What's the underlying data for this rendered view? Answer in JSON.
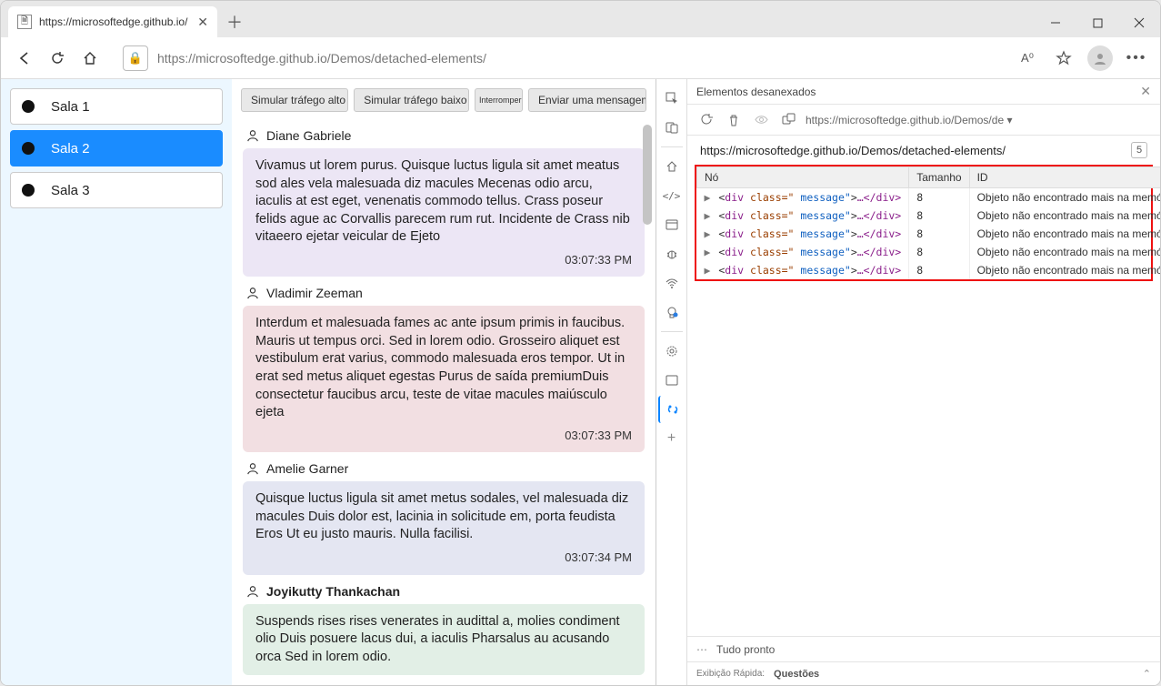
{
  "browser": {
    "tab_title": "https://microsoftedge.github.io/",
    "url": "https://microsoftedge.github.io/Demos/detached-elements/"
  },
  "sidebar": {
    "rooms": [
      {
        "label": "Sala 1",
        "active": false
      },
      {
        "label": "Sala 2",
        "active": true
      },
      {
        "label": "Sala 3",
        "active": false
      }
    ]
  },
  "buttons": {
    "high": "Simular tráfego alto",
    "low": "Simular tráfego baixo",
    "stop": "Interromper",
    "send": "Enviar uma mensagem"
  },
  "messages": [
    {
      "from": "Diane Gabriele",
      "color": "c1",
      "body": "Vivamus ut lorem purus. Quisque luctus ligula sit amet meatus sod ales vela malesuada diz macules  Mecenas odio arcu, iaculis at est eget, venenatis commodo tellus. Crass poseur felids ague ac Corvallis parecem rum rut. Incidente de Crass nib vitaeero ejetar veicular de Ejeto",
      "time": "03:07:33 PM"
    },
    {
      "from": "Vladimir Zeeman",
      "color": "c2",
      "body": "Interdum et malesuada fames ac ante ipsum primis in faucibus. Mauris ut tempus orci. Sed in lorem odio. Grosseiro aliquet est vestibulum erat varius, commodo malesuada eros tempor. Ut in erat sed metus aliquet egestas Purus de saída premiumDuis consectetur faucibus arcu, teste de vitae macules maiúsculo ejeta",
      "time": "03:07:33 PM"
    },
    {
      "from": "Amelie Garner",
      "color": "c3",
      "body": "Quisque luctus ligula sit amet metus sodales, vel malesuada diz macules       Duis dolor est, lacinia in solicitude em, porta feudista Eros       Ut eu justo mauris. Nulla facilisi.",
      "time": "03:07:34 PM"
    },
    {
      "from": "Joyikutty Thankachan",
      "color": "c4",
      "body": "Suspends rises rises venerates in audittal a, molies condiment olio       Duis posuere lacus dui, a iaculis Pharsalus au acusando orca       Sed in lorem odio.",
      "time": ""
    }
  ],
  "devtools": {
    "panel_title": "Elementos desanexados",
    "dropdown": "https://microsoftedge.github.io/Demos/de",
    "url": "https://microsoftedge.github.io/Demos/detached-elements/",
    "badge": "5",
    "columns": {
      "node": "Nó",
      "size": "Tamanho",
      "id": "ID"
    },
    "rows": [
      {
        "tag": "div",
        "attr": "class=\"",
        "val": "message\"",
        "close": "…</div>",
        "size": "8",
        "id": "Objeto não encontrado mais na memória"
      },
      {
        "tag": "div",
        "attr": "class=\"",
        "val": "message\"",
        "close": "…</div>",
        "size": "8",
        "id": "Objeto não encontrado mais na memória"
      },
      {
        "tag": "div",
        "attr": "class=\"",
        "val": "message\"",
        "close": "…</div>",
        "size": "8",
        "id": "Objeto não encontrado mais na memória"
      },
      {
        "tag": "div",
        "attr": "class=\"",
        "val": "message\"",
        "close": "…</div>",
        "size": "8",
        "id": "Objeto não encontrado mais na memória"
      },
      {
        "tag": "div",
        "attr": "class=\"",
        "val": "message\"",
        "close": "…</div>",
        "size": "8",
        "id": "Objeto não encontrado mais na memória"
      }
    ],
    "status": "Tudo pronto",
    "quick_label": "Exibição Rápida:",
    "quick_tab": "Questões"
  }
}
